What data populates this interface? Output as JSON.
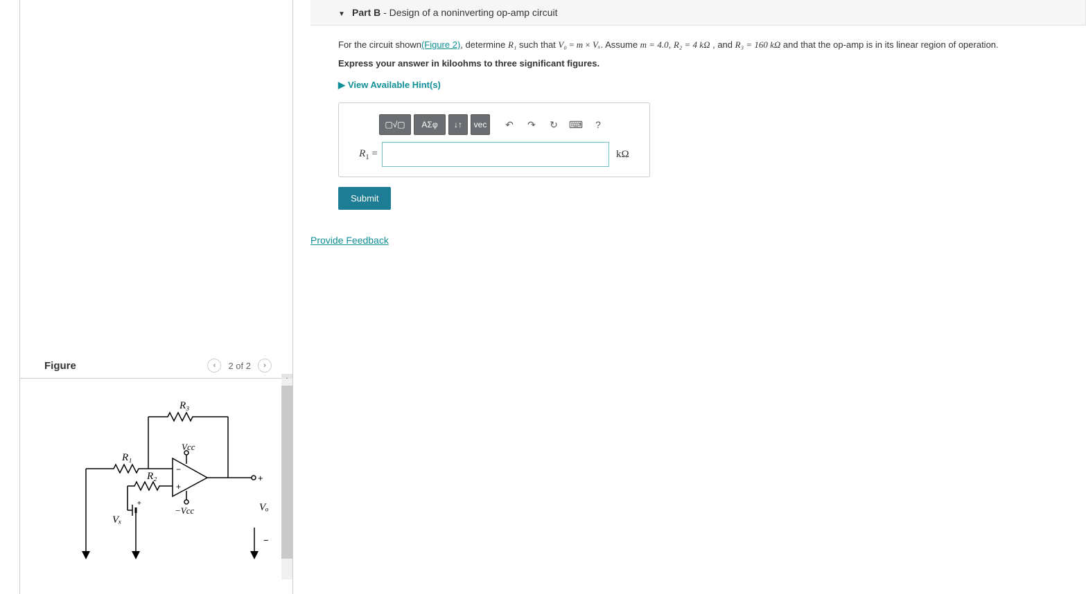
{
  "figure": {
    "title": "Figure",
    "page_label": "2 of 2",
    "labels": {
      "R1": "R₁",
      "R2": "R₂",
      "R3": "R₃",
      "Vcc": "Vcc",
      "nVcc": "−Vcc",
      "Vx": "Vₓ",
      "Vo": "Vₒ"
    }
  },
  "part": {
    "label": "Part B",
    "title_rest": " - Design of a noninverting op-amp circuit"
  },
  "question": {
    "prefix": "For the circuit shown",
    "fig_link": "(Figure 2)",
    "after_link": ", determine ",
    "var": "R₁",
    "such": " such that ",
    "eq_lhs": "V₀",
    "eq_mid": " = ",
    "eq_rhs1": "m",
    "eq_times": " × ",
    "eq_rhs2": "Vₓ",
    "assume": ". Assume ",
    "m_val": "m = 4.0",
    "sep1": ", ",
    "R2_val": "R₂ = 4 kΩ",
    "sep2": " , and ",
    "R3_val": "R₃ = 160 kΩ",
    "tail": " and that the op-amp is in its linear region of operation.",
    "express": "Express your answer in kiloohms to three significant figures.",
    "hints": "View Available Hint(s)"
  },
  "toolbar": {
    "templates": "▢√▢",
    "greek": "ΑΣφ",
    "subsup": "↓↑",
    "vec": "vec",
    "undo": "↶",
    "redo": "↷",
    "reset": "↻",
    "keyboard": "⌨",
    "help": "?"
  },
  "answer": {
    "label_var": "R",
    "label_sub": "1",
    "label_eq": " =",
    "value": "",
    "unit": "kΩ"
  },
  "buttons": {
    "submit": "Submit"
  },
  "feedback": "Provide Feedback"
}
